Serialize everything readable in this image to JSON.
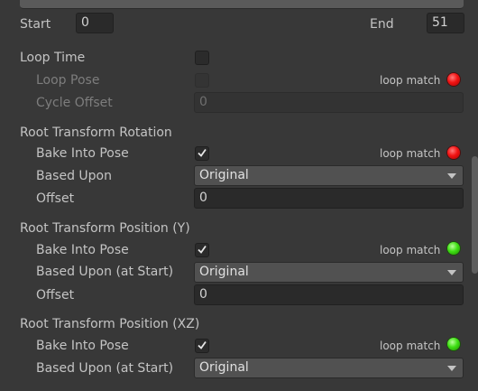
{
  "range": {
    "start_label": "Start",
    "start_value": "0",
    "end_label": "End",
    "end_value": "51"
  },
  "loop_time": {
    "label": "Loop Time",
    "loop_pose_label": "Loop Pose",
    "loop_match_label": "loop match",
    "loop_match_status": "red",
    "cycle_offset_label": "Cycle Offset",
    "cycle_offset_value": "0"
  },
  "root_rotation": {
    "label": "Root Transform Rotation",
    "bake_label": "Bake Into Pose",
    "loop_match_label": "loop match",
    "loop_match_status": "red",
    "based_upon_label": "Based Upon",
    "based_upon_value": "Original",
    "offset_label": "Offset",
    "offset_value": "0"
  },
  "root_position_y": {
    "label": "Root Transform Position (Y)",
    "bake_label": "Bake Into Pose",
    "loop_match_label": "loop match",
    "loop_match_status": "green",
    "based_upon_label": "Based Upon (at Start)",
    "based_upon_value": "Original",
    "offset_label": "Offset",
    "offset_value": "0"
  },
  "root_position_xz": {
    "label": "Root Transform Position (XZ)",
    "bake_label": "Bake Into Pose",
    "loop_match_label": "loop match",
    "loop_match_status": "green",
    "based_upon_label": "Based Upon (at Start)",
    "based_upon_value": "Original"
  },
  "colors": {
    "led_red": "#f21414",
    "led_green": "#3fe014"
  }
}
